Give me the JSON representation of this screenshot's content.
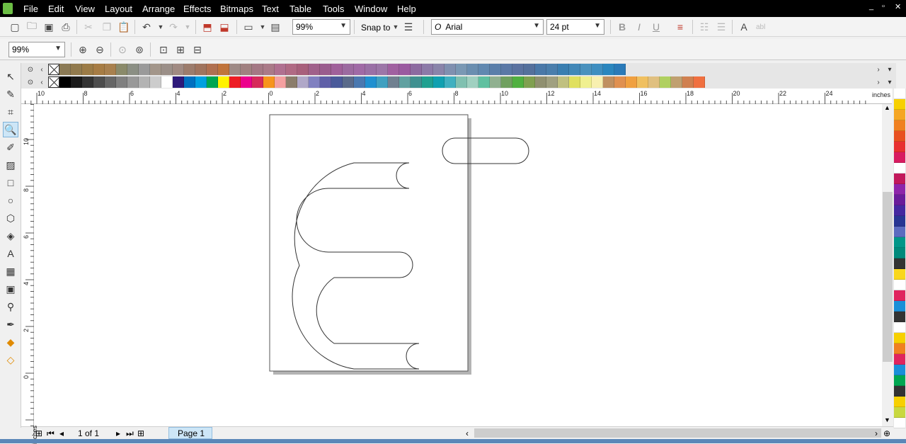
{
  "menu": [
    "File",
    "Edit",
    "View",
    "Layout",
    "Arrange",
    "Effects",
    "Bitmaps",
    "Text",
    "Table",
    "Tools",
    "Window",
    "Help"
  ],
  "window_buttons": [
    "_",
    "▫",
    "✕"
  ],
  "toolbar1": {
    "zoom_value": "99%",
    "snap_label": "Snap to",
    "font_name": "Arial",
    "font_size": "24 pt",
    "abc": "abl"
  },
  "toolbar2": {
    "zoom_value": "99%"
  },
  "ruler": {
    "unit": "inches",
    "h_labels": [
      "10",
      "8",
      "6",
      "4",
      "2",
      "0",
      "2",
      "4",
      "6",
      "8",
      "10",
      "12",
      "14",
      "16",
      "18",
      "20",
      "22",
      "24"
    ],
    "v_labels": [
      "10",
      "8",
      "6",
      "4",
      "2",
      "0"
    ]
  },
  "status": {
    "page_count": "1 of 1",
    "page_tab": "Page 1"
  },
  "colors": {
    "palette_top": [
      "#8b7a55",
      "#917a4d",
      "#9b7b46",
      "#a67c44",
      "#a8804e",
      "#8a8a6a",
      "#8b8f84",
      "#9a9a9a",
      "#a3968a",
      "#9b8f88",
      "#a08a82",
      "#9c7c6c",
      "#a0745e",
      "#b07050",
      "#c0743c",
      "#9e8a86",
      "#a08080",
      "#a47884",
      "#aa7a88",
      "#b07090",
      "#b06a84",
      "#a8607c",
      "#a0608a",
      "#9a5c8e",
      "#a0609a",
      "#9c6aa0",
      "#a06aa6",
      "#9a70a6",
      "#9c76a8",
      "#a060a0",
      "#9a5aa0",
      "#8c6aa0",
      "#8c7aa8",
      "#8a84aa",
      "#8090b0",
      "#7a98b4",
      "#6a8eb0",
      "#6088b0",
      "#5a7eaa",
      "#5a78a6",
      "#5a72a0",
      "#54709c",
      "#4a78a8",
      "#4a7eac",
      "#3a7eb0",
      "#4288b8",
      "#4a92be",
      "#3e8ec0",
      "#2a86be",
      "#2a7ab8"
    ],
    "palette_main": [
      "#000000",
      "#1a1a1a",
      "#333333",
      "#4d4d4d",
      "#666666",
      "#808080",
      "#999999",
      "#b3b3b3",
      "#cccccc",
      "#ffffff",
      "#2e1a7a",
      "#0070c0",
      "#00a0e0",
      "#00a651",
      "#fff200",
      "#ed1c24",
      "#ec008c",
      "#d62a5a",
      "#f7941d",
      "#f4a0a0",
      "#8b7d6b",
      "#b0a8c8",
      "#8080c0",
      "#6060a8",
      "#4a5a9a",
      "#5a6a8a",
      "#4a78b0",
      "#2090d0",
      "#40a0c0",
      "#708090",
      "#60a0a0",
      "#409090",
      "#20a090",
      "#10a0b0",
      "#40b0c0",
      "#80c0b0",
      "#a0d0c0",
      "#60c0a0",
      "#90b090",
      "#70a060",
      "#50b040",
      "#80a050",
      "#909070",
      "#a0a080",
      "#c0c080",
      "#e0e060",
      "#f0f090",
      "#f8f0b0",
      "#c09060",
      "#e09050",
      "#f0a040",
      "#f0c060",
      "#e0c080",
      "#b0d060",
      "#c0a070",
      "#d08050",
      "#f07040"
    ],
    "palette_right": [
      "#ffffff",
      "#f7d000",
      "#f5a623",
      "#f08020",
      "#e85020",
      "#e83030",
      "#d81b60",
      "#ffffff",
      "#c2185b",
      "#8e24aa",
      "#6a1b9a",
      "#4527a0",
      "#283593",
      "#5c6bc0",
      "#009688",
      "#00897b",
      "#333333",
      "#f9d71c",
      "#ffffff",
      "#e0245e",
      "#1a8fd8",
      "#333333",
      "#ffffff",
      "#f7d000",
      "#f08020",
      "#e0245e",
      "#1a8fd8",
      "#00a651",
      "#333333",
      "#f7d000",
      "#c8d840",
      "#ffffff"
    ]
  }
}
